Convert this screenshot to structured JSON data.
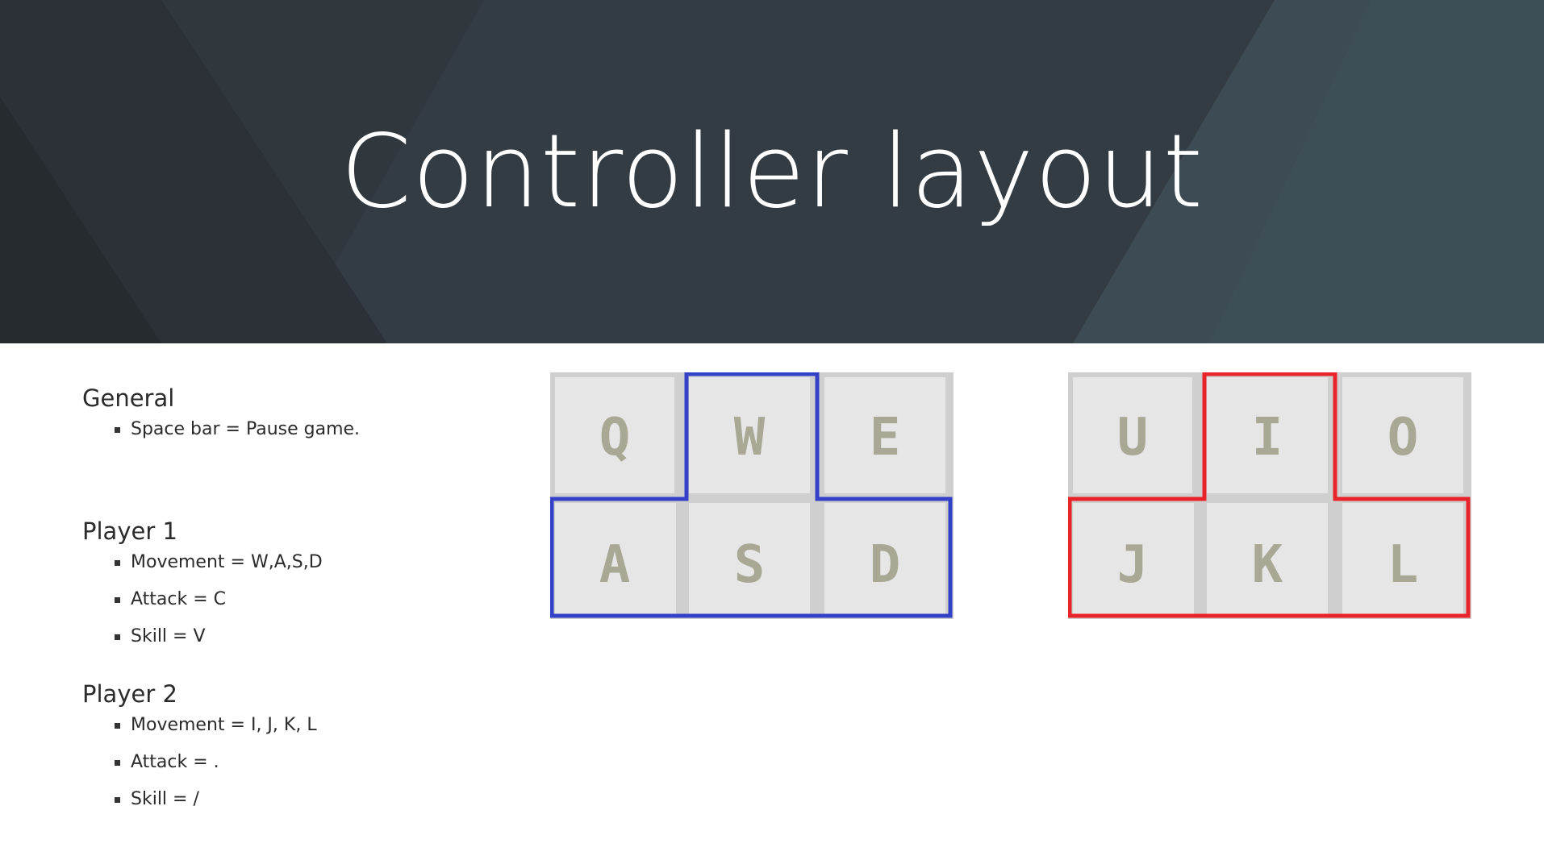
{
  "slide": {
    "title": "Controller layout"
  },
  "sections": {
    "general": {
      "heading": "General",
      "items": [
        "Space bar = Pause game."
      ]
    },
    "player1": {
      "heading": "Player 1",
      "items": [
        "Movement = W,A,S,D",
        "Attack = C",
        "Skill = V"
      ]
    },
    "player2": {
      "heading": "Player 2",
      "items": [
        "Movement = I, J, K, L",
        "Attack = .",
        "Skill = /"
      ]
    }
  },
  "keyboards": {
    "player1": {
      "top_row": [
        "Q",
        "W",
        "E"
      ],
      "bottom_row": [
        "A",
        "S",
        "D"
      ],
      "highlight_color": "#3340c8"
    },
    "player2": {
      "top_row": [
        "U",
        "I",
        "O"
      ],
      "bottom_row": [
        "J",
        "K",
        "L"
      ],
      "highlight_color": "#e8242a"
    }
  },
  "colors": {
    "header_bg": "#343c43",
    "key_face": "#e6e6e6",
    "key_label": "#a8a894"
  }
}
